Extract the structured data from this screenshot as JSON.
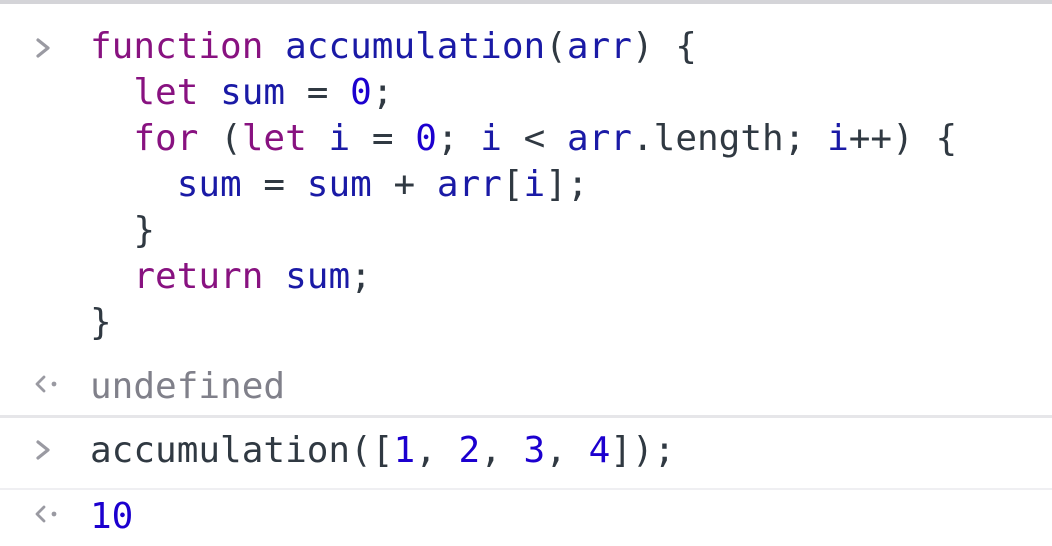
{
  "console": {
    "entries": [
      {
        "type": "input",
        "lines": [
          [
            {
              "t": "function",
              "c": "kw"
            },
            {
              "t": " ",
              "c": "plain"
            },
            {
              "t": "accumulation",
              "c": "fn"
            },
            {
              "t": "(",
              "c": "plain"
            },
            {
              "t": "arr",
              "c": "fn"
            },
            {
              "t": ") {",
              "c": "plain"
            }
          ],
          [
            {
              "t": "  ",
              "c": "plain"
            },
            {
              "t": "let",
              "c": "kw"
            },
            {
              "t": " ",
              "c": "plain"
            },
            {
              "t": "sum",
              "c": "fn"
            },
            {
              "t": " = ",
              "c": "plain"
            },
            {
              "t": "0",
              "c": "num"
            },
            {
              "t": ";",
              "c": "plain"
            }
          ],
          [
            {
              "t": "  ",
              "c": "plain"
            },
            {
              "t": "for",
              "c": "kw"
            },
            {
              "t": " (",
              "c": "plain"
            },
            {
              "t": "let",
              "c": "kw"
            },
            {
              "t": " ",
              "c": "plain"
            },
            {
              "t": "i",
              "c": "fn"
            },
            {
              "t": " = ",
              "c": "plain"
            },
            {
              "t": "0",
              "c": "num"
            },
            {
              "t": "; ",
              "c": "plain"
            },
            {
              "t": "i",
              "c": "fn"
            },
            {
              "t": " < ",
              "c": "plain"
            },
            {
              "t": "arr",
              "c": "fn"
            },
            {
              "t": ".length; ",
              "c": "plain"
            },
            {
              "t": "i",
              "c": "fn"
            },
            {
              "t": "++) {",
              "c": "plain"
            }
          ],
          [
            {
              "t": "    ",
              "c": "plain"
            },
            {
              "t": "sum",
              "c": "fn"
            },
            {
              "t": " = ",
              "c": "plain"
            },
            {
              "t": "sum",
              "c": "fn"
            },
            {
              "t": " + ",
              "c": "plain"
            },
            {
              "t": "arr",
              "c": "fn"
            },
            {
              "t": "[",
              "c": "plain"
            },
            {
              "t": "i",
              "c": "fn"
            },
            {
              "t": "];",
              "c": "plain"
            }
          ],
          [
            {
              "t": "  }",
              "c": "plain"
            }
          ],
          [
            {
              "t": "  ",
              "c": "plain"
            },
            {
              "t": "return",
              "c": "kw"
            },
            {
              "t": " ",
              "c": "plain"
            },
            {
              "t": "sum",
              "c": "fn"
            },
            {
              "t": ";",
              "c": "plain"
            }
          ],
          [
            {
              "t": "}",
              "c": "plain"
            }
          ]
        ]
      },
      {
        "type": "result",
        "value": "undefined"
      },
      {
        "type": "input",
        "lines": [
          [
            {
              "t": "accumulation([",
              "c": "plain"
            },
            {
              "t": "1",
              "c": "num"
            },
            {
              "t": ", ",
              "c": "plain"
            },
            {
              "t": "2",
              "c": "num"
            },
            {
              "t": ", ",
              "c": "plain"
            },
            {
              "t": "3",
              "c": "num"
            },
            {
              "t": ", ",
              "c": "plain"
            },
            {
              "t": "4",
              "c": "num"
            },
            {
              "t": "]);",
              "c": "plain"
            }
          ]
        ]
      },
      {
        "type": "result",
        "value": "10"
      }
    ],
    "icons": {
      "input_prompt": "chevron-right-icon",
      "result_prompt": "return-arrow-icon"
    },
    "colors": {
      "keyword": "#881280",
      "identifier": "#1a1aa6",
      "number": "#1c00cf",
      "text": "#303942",
      "undefined": "#80808a",
      "prompt": "#9a9aa2"
    }
  }
}
